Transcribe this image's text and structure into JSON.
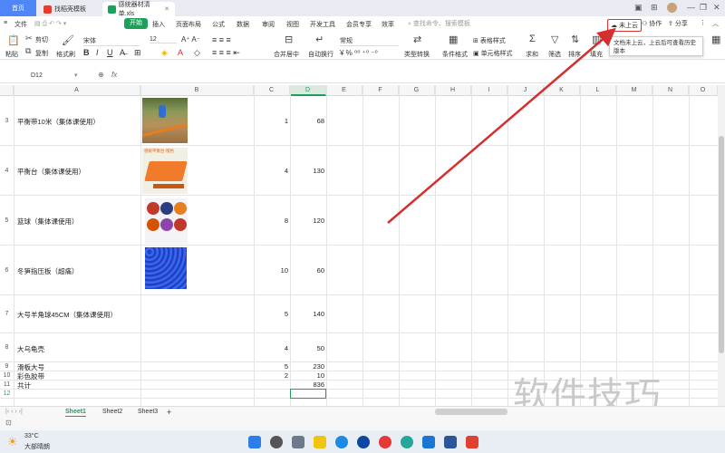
{
  "titlebar": {
    "tabs": [
      {
        "label": "首页"
      },
      {
        "label": "找稻壳模板"
      },
      {
        "label": "感统器材清单.xls"
      }
    ]
  },
  "menubar": {
    "file": "文件",
    "items": [
      "开始",
      "插入",
      "页面布局",
      "公式",
      "数据",
      "审阅",
      "视图",
      "开发工具",
      "会员专享",
      "效率"
    ],
    "search_placeholder": "查找命令、搜索模板",
    "cloud": "未上云",
    "collab": "协作",
    "share": "分享"
  },
  "ribbon": {
    "paste": "粘贴",
    "cut": "剪切",
    "copy": "复制",
    "format_painter": "格式刷",
    "font": "宋体",
    "size": "12",
    "merge": "合并居中",
    "wrap": "自动换行",
    "number_format": "常规",
    "type_convert": "类型转换",
    "cond_format": "条件格式",
    "table_style": "表格样式",
    "cell_style": "单元格样式",
    "sum": "求和",
    "filter": "筛选",
    "sort": "排序",
    "fill": "填充",
    "tooltip": "文档未上云，上云后可查看历史版本"
  },
  "formula": {
    "cell_ref": "D12",
    "fx": "fx"
  },
  "columns": [
    "A",
    "B",
    "C",
    "D",
    "E",
    "F",
    "G",
    "H",
    "I",
    "J",
    "K",
    "L",
    "M",
    "N",
    "O"
  ],
  "rows": [
    {
      "num": "3",
      "name": "平衡带10米（集体课使用）",
      "c": "1",
      "d": "68",
      "pic": "green"
    },
    {
      "num": "4",
      "name": "平衡台（集体课使用）",
      "c": "4",
      "d": "130",
      "pic": "orange"
    },
    {
      "num": "5",
      "name": "篮球（集体课使用）",
      "c": "8",
      "d": "120",
      "pic": "balls"
    },
    {
      "num": "6",
      "name": "冬笋指压板（超痛）",
      "c": "10",
      "d": "60",
      "pic": "blue"
    },
    {
      "num": "7",
      "name": "大号羊角球45CM（集体课使用）",
      "c": "5",
      "d": "140",
      "pic": ""
    },
    {
      "num": "8",
      "name": "大乌龟壳",
      "c": "4",
      "d": "50",
      "pic": ""
    },
    {
      "num": "9",
      "name": "滑板大号",
      "c": "5",
      "d": "230",
      "pic": ""
    },
    {
      "num": "10",
      "name": "彩色胶带",
      "c": "2",
      "d": "10",
      "pic": ""
    },
    {
      "num": "11",
      "name": "共计",
      "c": "",
      "d": "836",
      "pic": ""
    },
    {
      "num": "12",
      "name": "",
      "c": "",
      "d": "",
      "pic": ""
    }
  ],
  "pic_captions": {
    "orange": "感统平衡台·橙色"
  },
  "sheets": [
    "Sheet1",
    "Sheet2",
    "Sheet3"
  ],
  "weather": {
    "temp": "33°C",
    "desc": "大部晴朗"
  },
  "watermark": "软件技巧",
  "colors": {
    "accent_green": "#1e9f5b",
    "home_blue": "#4f86f7",
    "arrow_red": "#d32f2f"
  }
}
